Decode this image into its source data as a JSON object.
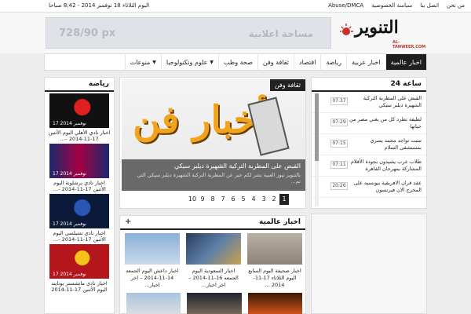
{
  "topbar": {
    "date": "اليوم الثلاثاء 18 نوفمبر 2014 - 8:42 صباحا",
    "links": [
      "من نحن",
      "اتصل بنا",
      "سياسة الخصوصية",
      "Abuse/DMCA"
    ]
  },
  "header": {
    "ad_size": "728/90 px",
    "ad_label": "مساحة اعلانية",
    "logo_text": "التنوير",
    "logo_sub": "AL-TANWEER.COM"
  },
  "nav": {
    "items": [
      "اخبار عالمية",
      "اخبار عربية",
      "رياضة",
      "اقتصاد",
      "ثقافة وفن",
      "صحة وطب",
      "علوم وتكنولوجيا",
      "منوعات"
    ]
  },
  "latest": {
    "title": "24 ساعة",
    "items": [
      {
        "time": "07:37",
        "text": "القبض على المطربة التركية الشهيرة ديلبر سيكي"
      },
      {
        "time": "07:29",
        "text": "لطيفة تطرد كل من يغني مصر من حياتها"
      },
      {
        "time": "07:15",
        "text": "سبت تواجد محمد يسري بمستشفى السلام"
      },
      {
        "time": "07:11",
        "text": "طلاب عرب يشيدون بجودة الأفلام المشاركة بمهرجان القاهرة"
      },
      {
        "time": "20:26",
        "text": "عقد قران الافريقية بيونسيه على المخرج الان فيرنسون"
      }
    ]
  },
  "slider": {
    "category": "ثقافة وفن",
    "image_text": "أخبار فن",
    "headline": "القبض على المطربة التركية الشهيرة ديلبر سيكي",
    "excerpt": "بالتنوير نيوز العبية نشر لكم خبر عن المطربة التركية الشهيرة ديلبر سيكي التي تم...",
    "pages": [
      "1",
      "2",
      "3",
      "4",
      "5",
      "6",
      "7",
      "8",
      "9",
      "10"
    ],
    "active_page": "1"
  },
  "world": {
    "title": "اخبار عالمية",
    "plus": "+",
    "cards": [
      {
        "text": "اخبار صحيفة اليوم السابع اليوم الثلاثاء 17-11-2014 ..."
      },
      {
        "text": "اخبار السعودية اليوم الجمعه 16-11-2014 – اخر اخبار..."
      },
      {
        "text": "اخبار داعش اليوم الجمعه 14-11-2014 – اخر اخبار..."
      }
    ]
  },
  "sports": {
    "title": "رياضة",
    "items": [
      {
        "date": "17 نوفمبر 2014",
        "text": "اخبار نادي الأهلي اليوم الأثنين 17-11-2014 –..."
      },
      {
        "date": "17 نوفمبر 2014",
        "text": "اخبار نادي برشلونة اليوم الأثنين 17-11-2014 –..."
      },
      {
        "date": "17 نوفمبر 2014",
        "text": "اخبار نادي تشيلسي اليوم الأثنين 17-11-2014 –..."
      },
      {
        "date": "17 نوفمبر 2014",
        "text": "اخبار نادي مانشستر يونايتد اليوم الأثنين 17-11-2014 –..."
      }
    ]
  },
  "colors": {
    "accent": "#1e1e1e",
    "ad_bg": "#dfe3e8",
    "logo_red": "#c9302c"
  }
}
